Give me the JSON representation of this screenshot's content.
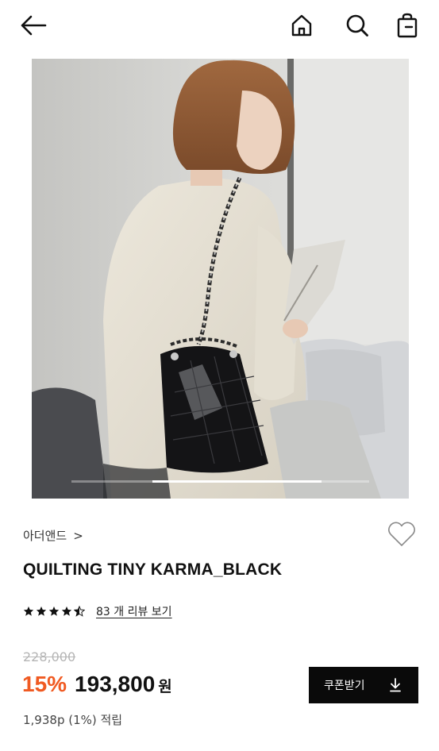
{
  "header": {
    "back_icon": "arrow-left-icon",
    "home_icon": "home-icon",
    "search_icon": "search-icon",
    "cart_icon": "shopping-bag-icon"
  },
  "hero": {
    "image_description": "product-photo",
    "slide_index": 2,
    "slide_count": 5
  },
  "product": {
    "brand": "아더앤드",
    "brand_chevron": ">",
    "name": "QUILTING TINY KARMA_BLACK",
    "rating": 4.5,
    "rating_max": 5,
    "reviews_label": "83 개 리뷰 보기",
    "original_price": "228,000",
    "discount": "15%",
    "price": "193,800",
    "currency": "원",
    "points": "1,938p (1%) 적립"
  },
  "coupon_button": {
    "label": "쿠폰받기",
    "icon": "download-icon"
  },
  "colors": {
    "discount": "#f05a22",
    "button_bg": "#0a0a0a",
    "strike": "#b5b5b5"
  }
}
